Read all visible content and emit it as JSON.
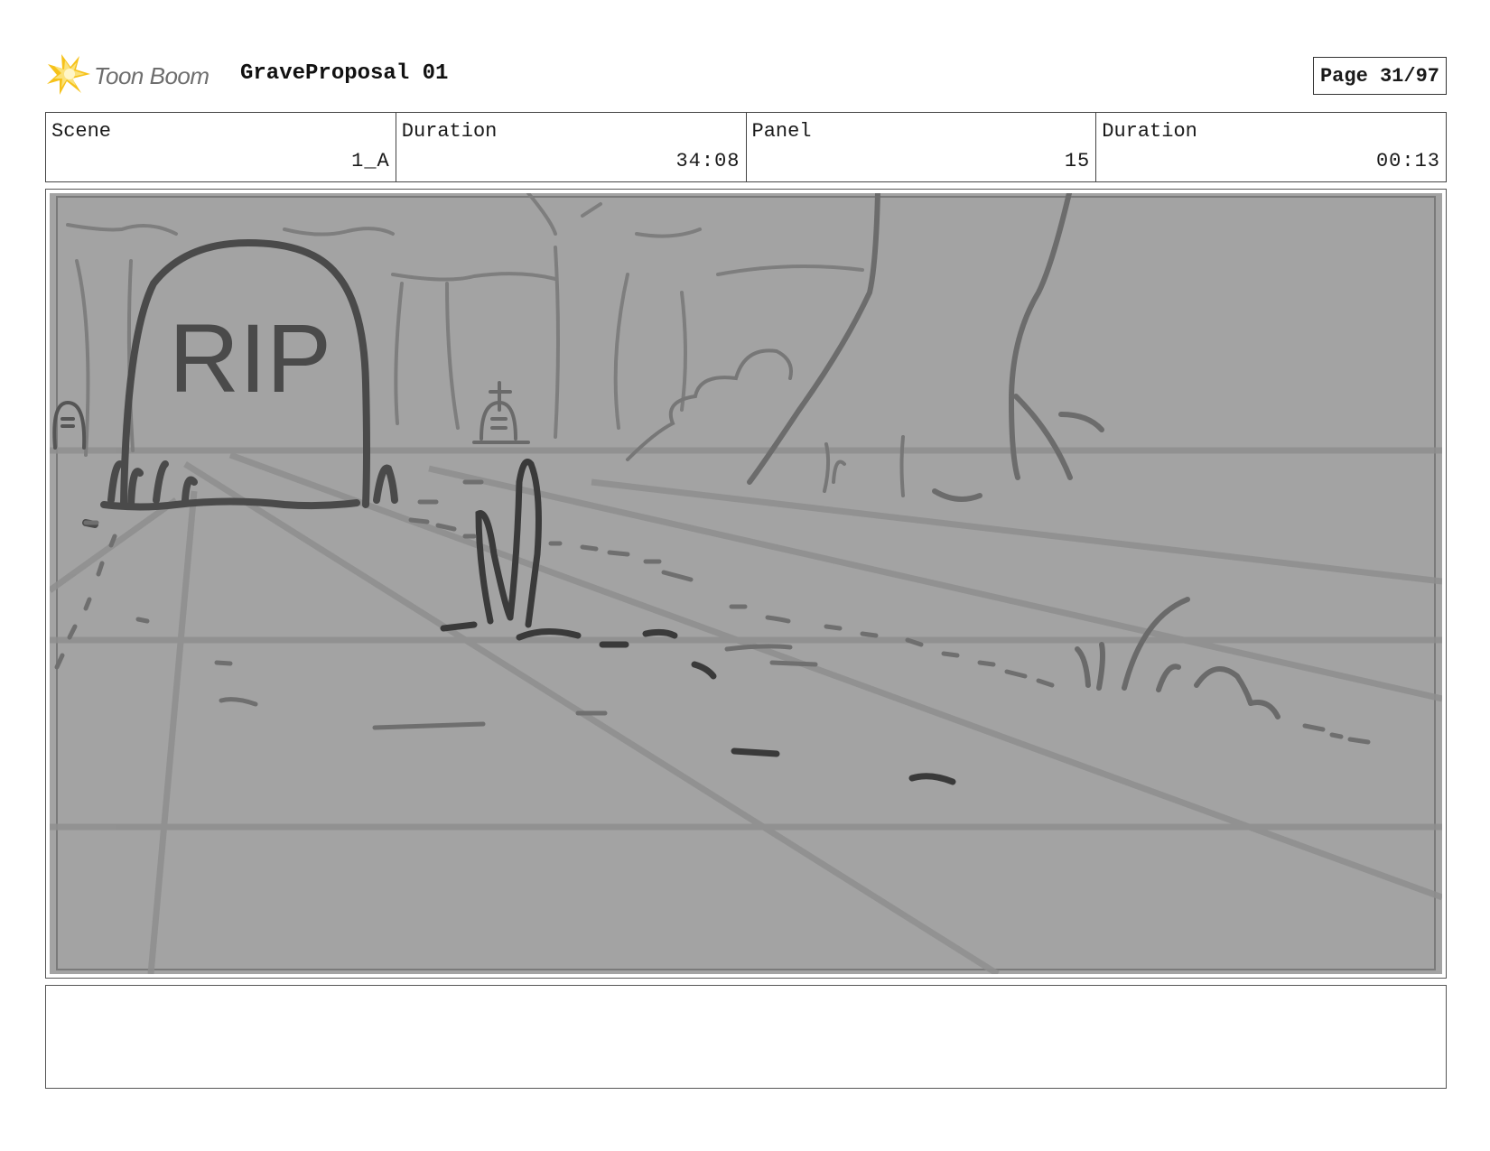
{
  "header": {
    "brand_name": "Toon Boom",
    "logo_icon": "star-burst-icon",
    "title": "GraveProposal 01",
    "page": "Page 31/97"
  },
  "info": {
    "scene_label": "Scene",
    "scene_value": "1_A",
    "duration_label": "Duration",
    "duration_value": "34:08",
    "panel_label": "Panel",
    "panel_value": "15",
    "panel_duration_label": "Duration",
    "panel_duration_value": "00:13"
  },
  "panel": {
    "sketch_text": "RIP",
    "background_color": "#a3a3a3"
  },
  "notes": {
    "text": ""
  }
}
